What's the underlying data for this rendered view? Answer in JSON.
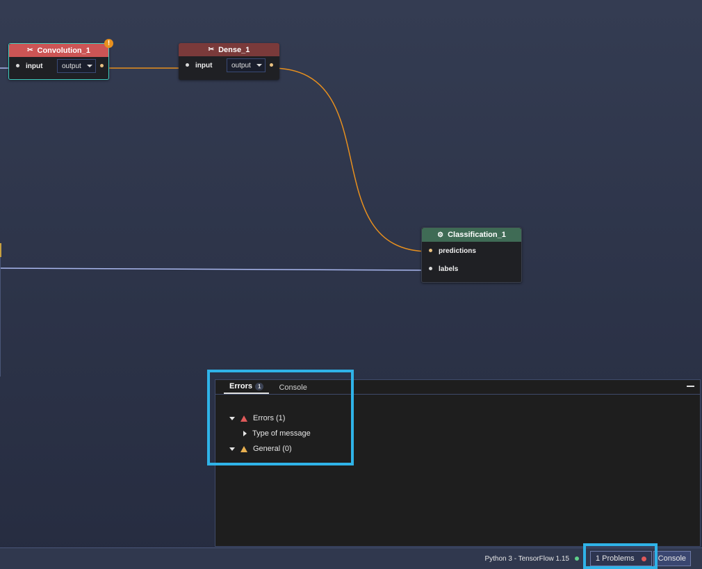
{
  "nodes": {
    "convolution": {
      "title": "Convolution_1",
      "input": "input",
      "output": "output",
      "warning": "!",
      "header_color": "#cc5555"
    },
    "dense": {
      "title": "Dense_1",
      "input": "input",
      "output": "output",
      "header_color": "#7a3a3a"
    },
    "classification": {
      "title": "Classification_1",
      "port1": "predictions",
      "port2": "labels",
      "header_color": "#3f6b55"
    }
  },
  "panel": {
    "tabs": [
      {
        "label": "Errors",
        "count": "1"
      },
      {
        "label": "Console"
      }
    ],
    "tree": {
      "errors": "Errors (1)",
      "type_of_message": "Type of message",
      "general": "General (0)"
    }
  },
  "statusbar": {
    "kernel": "Python 3 - TensorFlow 1.15",
    "problems": "1 Problems",
    "console": "Console"
  },
  "colors": {
    "wire": "#e8901e",
    "wire_labels": "#aab8f0",
    "highlight": "#2fb3e8"
  }
}
